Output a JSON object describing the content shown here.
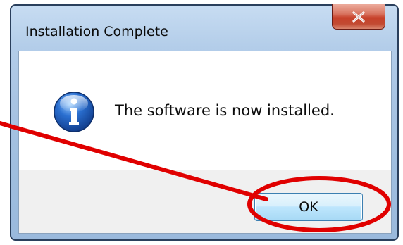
{
  "dialog": {
    "title": "Installation Complete",
    "message": "The software is now installed.",
    "ok_label": "OK",
    "close_glyph": "x"
  },
  "icons": {
    "close": "close-icon",
    "info": "info-icon"
  },
  "colors": {
    "annotation": "#e00000",
    "close_button": "#c7412a",
    "frame": "#b3cde9"
  }
}
